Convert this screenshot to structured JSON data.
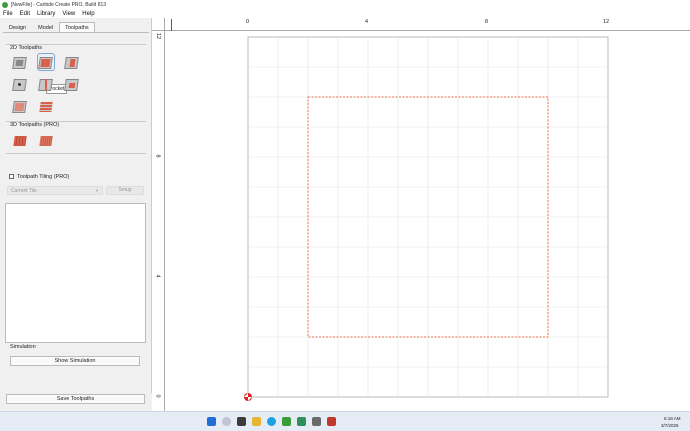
{
  "window": {
    "title": "[NewFile] - Carbide Create PRO, Build 813"
  },
  "menu": [
    "File",
    "Edit",
    "Library",
    "View",
    "Help"
  ],
  "tabs": [
    "Design",
    "Model",
    "Toolpaths"
  ],
  "toolpaths2d": {
    "label": "2D Toolpaths",
    "tooltip": "Pocket"
  },
  "toolpaths3d": {
    "label": "3D Toolpaths (PRO)"
  },
  "tiling": {
    "label": "Toolpath Tiling (PRO)",
    "current_tile_placeholder": "Current Tile",
    "setup_label": "Setup"
  },
  "simulation": {
    "label": "Simulation",
    "show_label": "Show Simulation"
  },
  "save_label": "Save Toolpaths",
  "ruler": {
    "top_ticks": [
      "0",
      "4",
      "8",
      "12"
    ],
    "left_ticks": [
      "12",
      "8",
      "4",
      "0"
    ]
  },
  "colors": {
    "accent": "#d9604a",
    "selection_dash": "#e8704a",
    "grid": "#e2e2e2"
  },
  "taskbar": {
    "time": "6:18 AM",
    "date": "3/7/2025"
  }
}
